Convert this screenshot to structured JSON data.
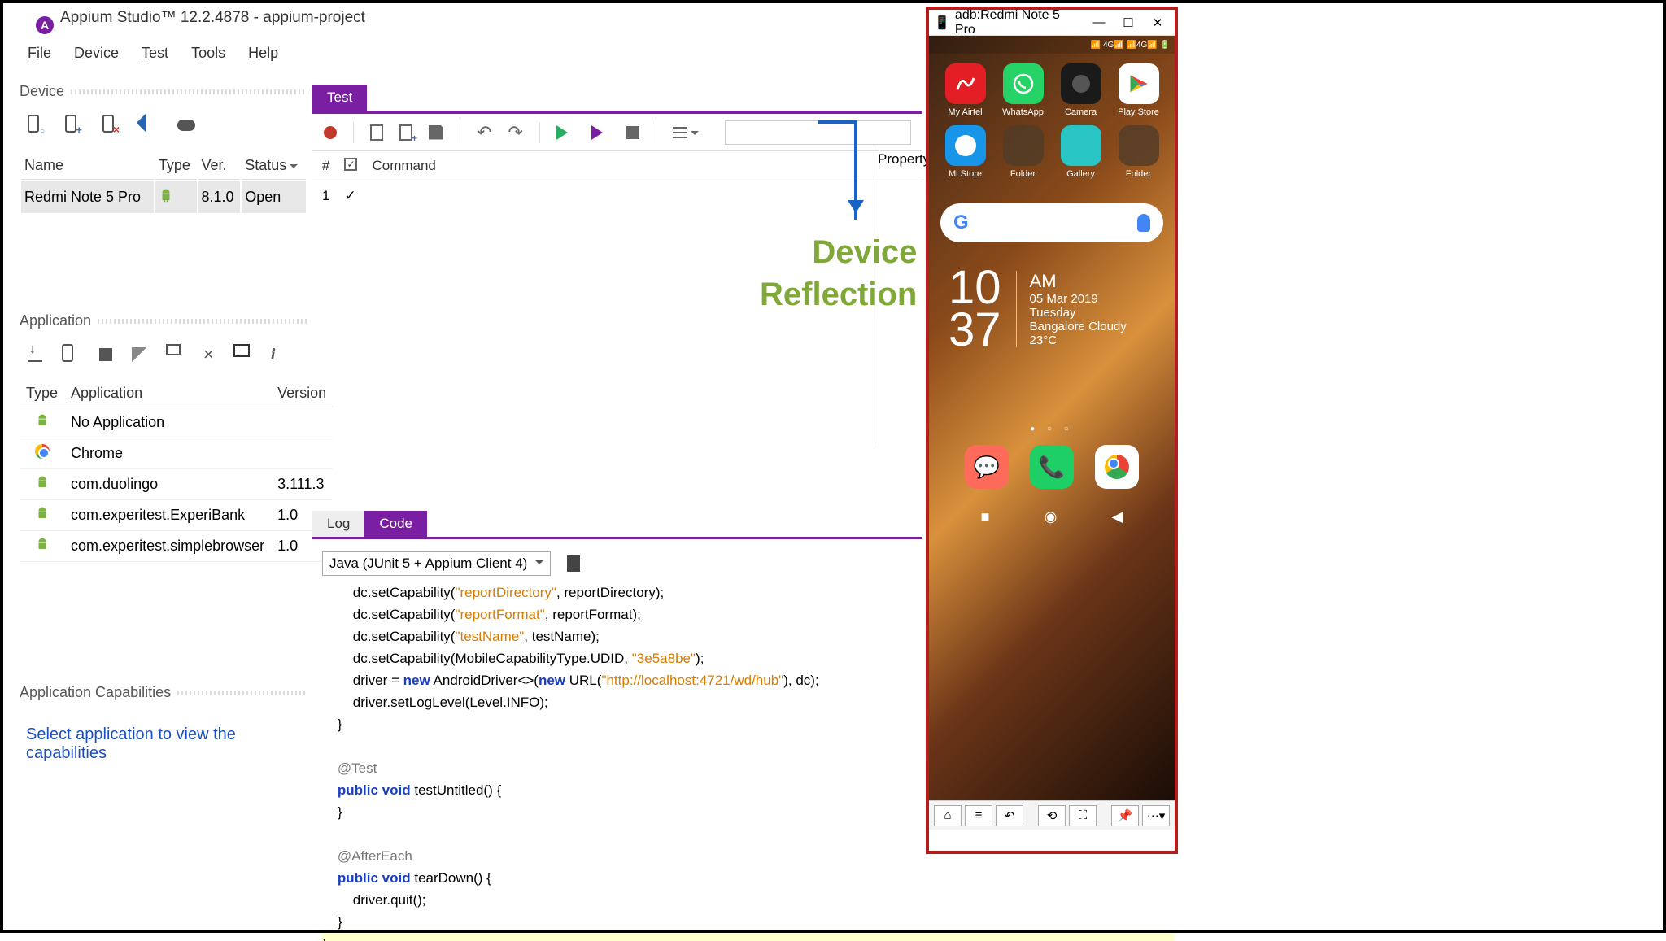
{
  "window": {
    "title": "Appium Studio™ 12.2.4878 - appium-project"
  },
  "menubar": [
    "File",
    "Device",
    "Test",
    "Tools",
    "Help"
  ],
  "device_panel": {
    "title": "Device",
    "columns": [
      "Name",
      "Type",
      "Ver.",
      "Status"
    ],
    "rows": [
      {
        "name": "Redmi Note 5 Pro",
        "ver": "8.1.0",
        "status": "Open"
      }
    ]
  },
  "app_panel": {
    "title": "Application",
    "columns": [
      "Type",
      "Application",
      "Version"
    ],
    "rows": [
      {
        "app": "No Application",
        "ver": ""
      },
      {
        "app": "Chrome",
        "ver": "",
        "icon": "chrome"
      },
      {
        "app": "com.duolingo",
        "ver": "3.111.3"
      },
      {
        "app": "com.experitest.ExperiBank",
        "ver": "1.0"
      },
      {
        "app": "com.experitest.simplebrowser",
        "ver": "1.0"
      }
    ]
  },
  "cap_panel": {
    "title": "Application Capabilities",
    "message": "Select application to view the capabilities"
  },
  "center": {
    "tab": "Test",
    "cmd_col": "Command",
    "hash": "#",
    "row1": "1",
    "property": "Property",
    "bottom_tabs": {
      "log": "Log",
      "code": "Code"
    },
    "lang": "Java (JUnit 5 + Appium Client 4)"
  },
  "annotation": {
    "l1": "Device",
    "l2": "Reflection"
  },
  "code": {
    "l1a": "        dc.setCapability(",
    "l1s": "\"reportDirectory\"",
    "l1b": ", reportDirectory);",
    "l2a": "        dc.setCapability(",
    "l2s": "\"reportFormat\"",
    "l2b": ", reportFormat);",
    "l3a": "        dc.setCapability(",
    "l3s": "\"testName\"",
    "l3b": ", testName);",
    "l4a": "        dc.setCapability(MobileCapabilityType.UDID, ",
    "l4s": "\"3e5a8be\"",
    "l4b": ");",
    "l5a": "        driver = ",
    "l5k": "new",
    "l5b": " AndroidDriver<>(",
    "l5k2": "new",
    "l5c": " URL(",
    "l5s": "\"http://localhost:4721/wd/hub\"",
    "l5d": "), dc);",
    "l6": "        driver.setLogLevel(Level.INFO);",
    "l7": "    }",
    "l8": "",
    "l9": "    @Test",
    "l10a": "    ",
    "l10k": "public void",
    "l10b": " testUntitled() {",
    "l11": "    }",
    "l12": "",
    "l13": "    @AfterEach",
    "l14a": "    ",
    "l14k": "public void",
    "l14b": " tearDown() {",
    "l15": "        driver.quit();",
    "l16": "    }",
    "l17": "}"
  },
  "device_window": {
    "title": "adb:Redmi Note 5 Pro",
    "status": "📶 4G📶 📶4G📶 🔋",
    "apps_row1": [
      {
        "n": "My Airtel",
        "c": "airtel",
        "t": "a"
      },
      {
        "n": "WhatsApp",
        "c": "whatsapp",
        "t": "📞"
      },
      {
        "n": "Camera",
        "c": "camera",
        "t": ""
      },
      {
        "n": "Play Store",
        "c": "playstore",
        "t": ""
      }
    ],
    "apps_row2": [
      {
        "n": "Mi Store",
        "c": "mistore",
        "t": ""
      },
      {
        "n": "Folder",
        "c": "folder",
        "t": ""
      },
      {
        "n": "Gallery",
        "c": "gallery",
        "t": "🖼"
      },
      {
        "n": "Folder",
        "c": "folder",
        "t": ""
      }
    ],
    "clock": {
      "h": "10",
      "m": "37",
      "ampm": "AM",
      "date": "05 Mar 2019",
      "day": "Tuesday",
      "weather": "Bangalore  Cloudy  23°C"
    }
  }
}
